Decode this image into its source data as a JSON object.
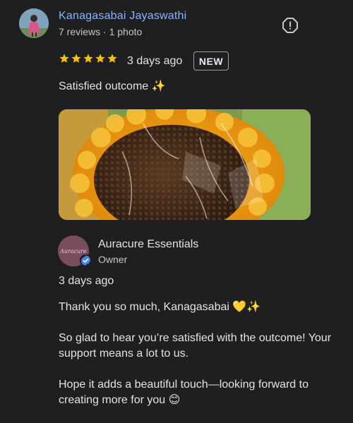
{
  "reviewer": {
    "name": "Kanagasabai Jayaswathi",
    "meta": "7 reviews · 1 photo"
  },
  "review": {
    "rating": 5,
    "date": "3 days ago",
    "badge": "NEW",
    "text": "Satisfied outcome ✨"
  },
  "photo": {
    "icon": "sunflower-crochet-photo"
  },
  "owner": {
    "name": "Auracure Essentials",
    "role": "Owner",
    "avatar_text": "Auracure",
    "reply_date": "3 days ago",
    "reply_paragraphs": [
      "Thank you so much, Kanagasabai 💛✨",
      "So glad to hear you’re satisfied with the outcome! Your support means a lot to us.",
      "Hope it adds a beautiful touch—looking forward to creating more for you 😊"
    ]
  },
  "colors": {
    "background": "#1f1f21",
    "link_blue": "#8ab4f8",
    "star": "#fbbc04",
    "verified": "#4285f4"
  }
}
